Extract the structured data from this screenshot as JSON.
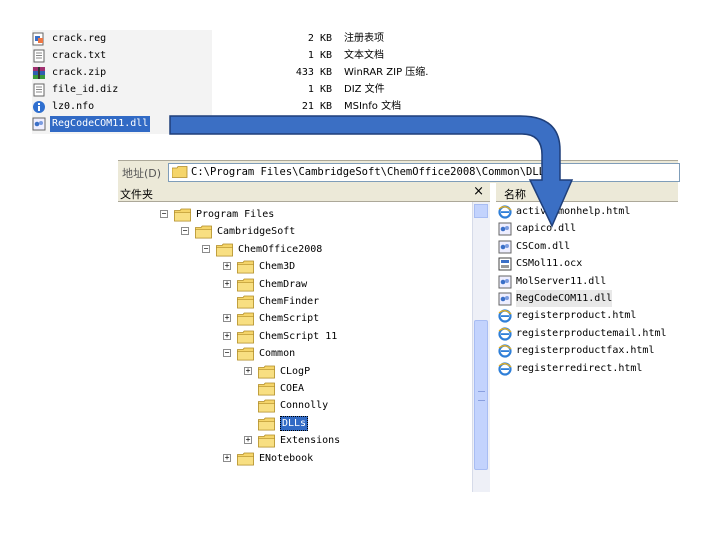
{
  "source_files": [
    {
      "name": "crack.reg",
      "size": "2 KB",
      "type": "注册表项",
      "icon": "registry-file-icon"
    },
    {
      "name": "crack.txt",
      "size": "1 KB",
      "type": "文本文档",
      "icon": "text-file-icon"
    },
    {
      "name": "crack.zip",
      "size": "433 KB",
      "type": "WinRAR ZIP 压缩.",
      "icon": "winrar-archive-icon"
    },
    {
      "name": "file_id.diz",
      "size": "1 KB",
      "type": "DIZ 文件",
      "icon": "text-file-icon"
    },
    {
      "name": "lz0.nfo",
      "size": "21 KB",
      "type": "MSInfo 文档",
      "icon": "info-file-icon"
    },
    {
      "name": "RegCodeCOM11.dll",
      "size": "",
      "type": "",
      "icon": "dll-file-icon",
      "selected": true
    }
  ],
  "address": {
    "label": "地址(D)",
    "path": "C:\\Program Files\\CambridgeSoft\\ChemOffice2008\\Common\\DLLs"
  },
  "folders_pane": {
    "title": "文件夹",
    "close": "×",
    "nodes": [
      {
        "label": "Program Files",
        "expander": "−"
      },
      {
        "label": "CambridgeSoft",
        "expander": "−"
      },
      {
        "label": "ChemOffice2008",
        "expander": "−"
      },
      {
        "label": "Chem3D",
        "expander": "+"
      },
      {
        "label": "ChemDraw",
        "expander": "+"
      },
      {
        "label": "ChemFinder",
        "expander": ""
      },
      {
        "label": "ChemScript",
        "expander": "+"
      },
      {
        "label": "ChemScript 11",
        "expander": "+"
      },
      {
        "label": "Common",
        "expander": "−"
      },
      {
        "label": "CLogP",
        "expander": "+"
      },
      {
        "label": "COEA",
        "expander": ""
      },
      {
        "label": "Connolly",
        "expander": ""
      },
      {
        "label": "DLLs",
        "expander": "",
        "selected": true
      },
      {
        "label": "Extensions",
        "expander": "+"
      },
      {
        "label": "ENotebook",
        "expander": "+"
      }
    ]
  },
  "files_pane": {
    "column": "名称",
    "files": [
      {
        "name": "activeXmonhelp.html",
        "icon": "ie-html-icon"
      },
      {
        "name": "capico.dll",
        "icon": "dll-file-icon"
      },
      {
        "name": "CSCom.dll",
        "icon": "dll-file-icon"
      },
      {
        "name": "CSMol11.ocx",
        "icon": "ocx-file-icon"
      },
      {
        "name": "MolServer11.dll",
        "icon": "dll-file-icon"
      },
      {
        "name": "RegCodeCOM11.dll",
        "icon": "dll-file-icon",
        "selected": true
      },
      {
        "name": "registerproduct.html",
        "icon": "ie-html-icon"
      },
      {
        "name": "registerproductemail.html",
        "icon": "ie-html-icon"
      },
      {
        "name": "registerproductfax.html",
        "icon": "ie-html-icon"
      },
      {
        "name": "registerredirect.html",
        "icon": "ie-html-icon"
      }
    ]
  },
  "colors": {
    "selection": "#316ac5",
    "arrow_fill": "#3b6fc4",
    "arrow_stroke": "#1f3f7a",
    "folder": "#f5d56a"
  }
}
